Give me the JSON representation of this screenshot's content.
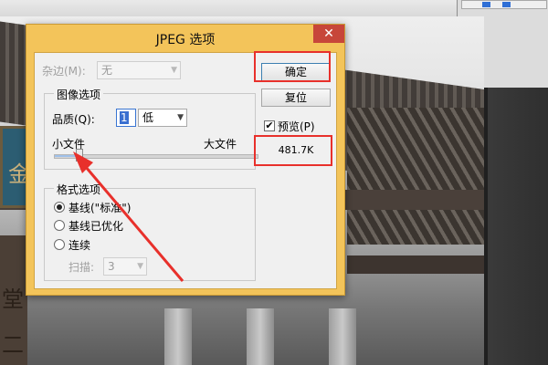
{
  "dialog": {
    "title": "JPEG 选项",
    "close_glyph": "✕",
    "matte": {
      "label": "杂边(M):",
      "value": "无"
    },
    "image_options": {
      "group_title": "图像选项",
      "quality_label": "品质(Q):",
      "quality_value": "1",
      "quality_level": "低",
      "small_file_label": "小文件",
      "large_file_label": "大文件",
      "slider_position": 0.125
    },
    "format_options": {
      "group_title": "格式选项",
      "options": [
        {
          "label": "基线(\"标准\")",
          "selected": true
        },
        {
          "label": "基线已优化",
          "selected": false
        },
        {
          "label": "连续",
          "selected": false
        }
      ],
      "scans_label": "扫描:",
      "scans_value": "3"
    },
    "buttons": {
      "ok_label": "确定",
      "reset_label": "复位"
    },
    "preview": {
      "label": "预览(P)",
      "checked": true,
      "check_glyph": "✔"
    },
    "file_size": "481.7K",
    "dropdown_arrow": "▼"
  },
  "background": {
    "plaque_char": "金",
    "sign_char_1": "堂",
    "sign_char_2": "二"
  },
  "colors": {
    "dialog_frame": "#f3c45a",
    "close_button": "#c7463a",
    "annotation_red": "#e8302b",
    "selection_blue": "#3a6fd0"
  }
}
